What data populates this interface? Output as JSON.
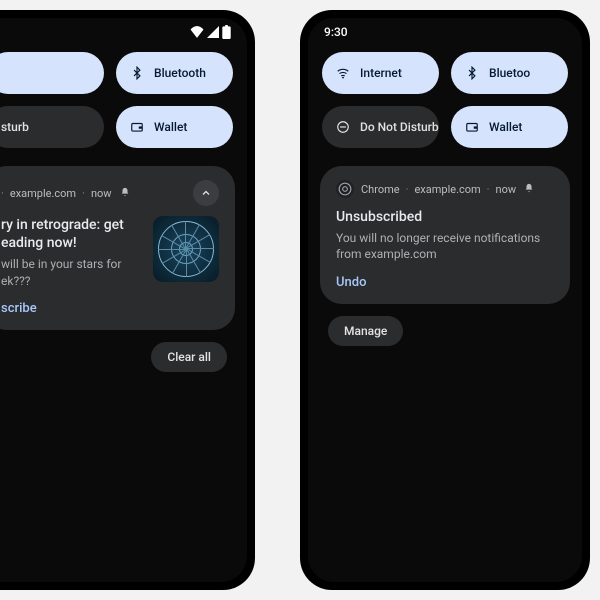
{
  "left": {
    "qs": {
      "r1": {
        "tile1_label": "",
        "tile2_label": "Bluetooth"
      },
      "r2": {
        "tile1_label": "sturb",
        "tile2_label": "Wallet"
      }
    },
    "notif": {
      "source": "example.com",
      "time": "now",
      "title": "ry in retrograde: get eading now!",
      "sub": "will be in your stars for ek???",
      "action": "scribe",
      "thumb_alt": "zodiac wheel"
    },
    "footer": {
      "clear": "Clear all"
    }
  },
  "right": {
    "status": {
      "time": "9:30"
    },
    "qs": {
      "r1": {
        "tile1_label": "Internet",
        "tile2_label": "Bluetoo"
      },
      "r2": {
        "tile1_label": "Do Not Disturb",
        "tile2_label": "Wallet"
      }
    },
    "notif": {
      "app": "Chrome",
      "source": "example.com",
      "time": "now",
      "title": "Unsubscribed",
      "sub": "You will no longer receive notifications from example.com",
      "action": "Undo"
    },
    "footer": {
      "manage": "Manage"
    }
  }
}
